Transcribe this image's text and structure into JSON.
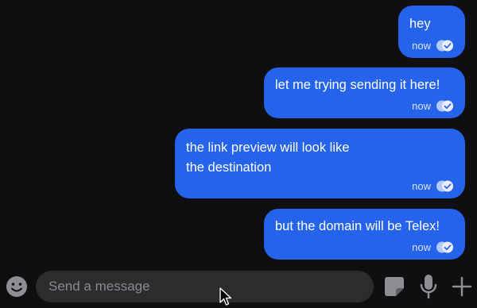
{
  "messages": [
    {
      "text": "hey",
      "time": "now",
      "status_icon": "double-check-icon"
    },
    {
      "text": "let me trying sending it here!",
      "time": "now",
      "status_icon": "double-check-icon"
    },
    {
      "text": "the link preview will look like\nthe destination",
      "time": "now",
      "status_icon": "double-check-icon"
    },
    {
      "text": "but the domain will be Telex!",
      "time": "now",
      "status_icon": "double-check-icon"
    }
  ],
  "composer": {
    "placeholder": "Send a message",
    "value": "",
    "icons": [
      "emoji-icon",
      "sticker-icon",
      "microphone-icon",
      "plus-icon"
    ]
  },
  "colors": {
    "background": "#0f0e10",
    "bubble": "#2563eb",
    "input": "#2c2c2f",
    "icon": "#8e8e93"
  }
}
